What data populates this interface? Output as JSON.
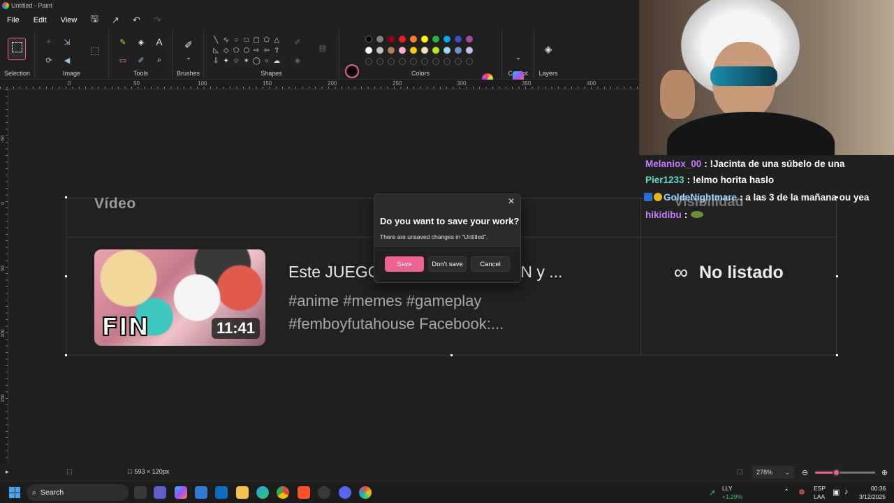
{
  "window": {
    "title": "Untitled - Paint"
  },
  "menu": {
    "file": "File",
    "edit": "Edit",
    "view": "View"
  },
  "ribbon": {
    "groups": {
      "selection": "Selection",
      "image": "Image",
      "tools": "Tools",
      "brushes": "Brushes",
      "shapes": "Shapes",
      "colors": "Colors",
      "copilot": "Copilot",
      "layers": "Layers"
    },
    "palette_row1": [
      "#000000",
      "#7f7f7f",
      "#880015",
      "#ed1c24",
      "#ff7f27",
      "#fff200",
      "#22b14c",
      "#00a2e8",
      "#3f48cc",
      "#a349a4"
    ],
    "palette_row2": [
      "#ffffff",
      "#c3c3c3",
      "#b97a57",
      "#ffaec9",
      "#ffc90e",
      "#efe4b0",
      "#b5e61d",
      "#99d9ea",
      "#7092be",
      "#c8bfe7"
    ],
    "accent_color": "#f06292"
  },
  "ruler": {
    "top_labels": [
      "0",
      "50",
      "100",
      "150",
      "200",
      "250",
      "300",
      "350",
      "400"
    ],
    "left_labels": [
      "-50",
      "0",
      "50",
      "100",
      "150"
    ]
  },
  "canvas": {
    "video_header": "Vídeo",
    "visibility_header": "Visibilidad",
    "thumbnail_text": "FIN",
    "duration": "11:41",
    "video_title": "Este JUEGO me dio DEPRESIÓN y ...",
    "description_line1": "#anime #memes #gameplay",
    "description_line2": "#femboyfutahouse Facebook:...",
    "visibility_value": "No listado"
  },
  "dialog": {
    "title": "Do you want to save your work?",
    "message": "There are unsaved changes in \"Untitled\".",
    "save": "Save",
    "dont_save": "Don't save",
    "cancel": "Cancel"
  },
  "chat": [
    {
      "user": "Melaniox_00",
      "color": "#c77dff",
      "message": ": !Jacinta de una súbelo de una"
    },
    {
      "user": "Pier1233",
      "color": "#5fe0c8",
      "message": ": !elmo horita haslo"
    },
    {
      "user": "GoldeNightmare",
      "color": "#9fd3ff",
      "message": ": a las 3 de la mañana ou yea"
    },
    {
      "user": "hikidibu",
      "color": "#c77dff",
      "message": ":"
    }
  ],
  "statusbar": {
    "canvas_size": "593 × 120px",
    "zoom": "278%",
    "zoom_fraction": 0.35
  },
  "taskbar": {
    "search": "Search",
    "stock_name": "LLY",
    "stock_change": "+1.29%",
    "lang1": "ESP",
    "lang2": "LAA",
    "time": "00:36",
    "date": "3/12/2025"
  }
}
